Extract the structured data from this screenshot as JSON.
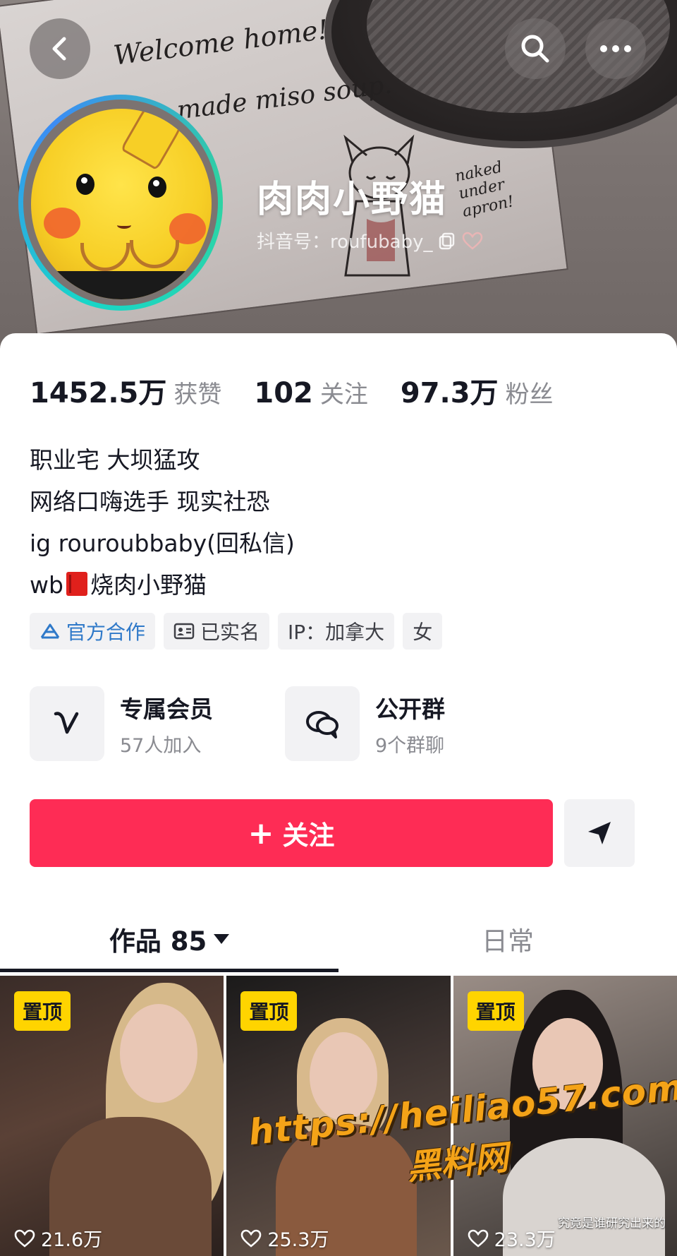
{
  "header": {
    "cover_note_lines": [
      "Welcome home!",
      "made miso soup.",
      "naked\nunder\napron!"
    ],
    "nickname": "肉肉小野猫",
    "douyin_id": "抖音号：roufubaby_",
    "icons": {
      "back": "chevron-left-icon",
      "search": "search-icon",
      "more": "more-horizontal-icon",
      "copy": "copy-icon",
      "heart": "heart-outline-icon"
    }
  },
  "stats": [
    {
      "value": "1452.5万",
      "label": "获赞"
    },
    {
      "value": "102",
      "label": "关注"
    },
    {
      "value": "97.3万",
      "label": "粉丝"
    }
  ],
  "bio": {
    "lines": [
      "职业宅 大坝猛攻",
      "网络口嗨选手 现实社恐",
      "ig rouroubbaby(回私信)"
    ],
    "wb_prefix": "wb",
    "wb_name": "烧肉小野猫"
  },
  "tags": [
    {
      "label": "官方合作",
      "icon": "official-partner-icon"
    },
    {
      "label": "已实名",
      "icon": "id-card-icon"
    },
    {
      "label": "IP：加拿大"
    },
    {
      "label": "女"
    }
  ],
  "features": [
    {
      "title": "专属会员",
      "subtitle": "57人加入",
      "icon": "member-v-icon"
    },
    {
      "title": "公开群",
      "subtitle": "9个群聊",
      "icon": "group-chat-icon"
    }
  ],
  "actions": {
    "follow_label": "关注",
    "follow_icon": "plus-icon",
    "share_icon": "share-send-icon"
  },
  "tabs": {
    "works_label": "作品 85",
    "daily_label": "日常"
  },
  "videos": [
    {
      "pin_label": "置顶",
      "likes": "21.6万"
    },
    {
      "pin_label": "置顶",
      "likes": "25.3万"
    },
    {
      "pin_label": "置顶",
      "likes": "23.3万",
      "caption": "究竟是谁研究出来的"
    }
  ],
  "watermark": {
    "url": "https://heiliao57.com",
    "name": "黑料网"
  },
  "colors": {
    "accent": "#fe2c55",
    "pin": "#ffd400",
    "official": "#2f79c9",
    "muted": "#8a8b91"
  }
}
